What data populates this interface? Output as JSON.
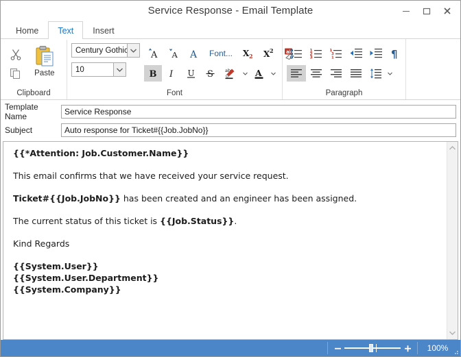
{
  "window": {
    "title": "Service Response - Email Template",
    "controls": {
      "minimize": "–",
      "maximize": "□",
      "close": "✕"
    }
  },
  "tabs": [
    {
      "label": "Home",
      "active": false
    },
    {
      "label": "Text",
      "active": true
    },
    {
      "label": "Insert",
      "active": false
    }
  ],
  "ribbon": {
    "clipboard": {
      "group_label": "Clipboard",
      "cut_label": "Cut",
      "copy_label": "Copy",
      "paste_label": "Paste"
    },
    "font": {
      "group_label": "Font",
      "font_name": "Century Gothic",
      "font_size": "10",
      "grow_font_label": "Grow Font",
      "shrink_font_label": "Shrink Font",
      "change_case_label": "A",
      "font_dialog_label": "Font...",
      "subscript_label": "Subscript",
      "superscript_label": "Superscript",
      "clear_formatting_label": "Clear Formatting",
      "bold_label": "B",
      "italic_label": "I",
      "underline_label": "U",
      "strikethrough_label": "S",
      "highlight_label": "Text Highlight",
      "font_color_label": "A"
    },
    "paragraph": {
      "group_label": "Paragraph",
      "bullets_label": "Bullets",
      "numbering_label": "Numbering",
      "multilevel_label": "Multilevel List",
      "decrease_indent_label": "Decrease Indent",
      "increase_indent_label": "Increase Indent",
      "show_marks_label": "¶",
      "align_left_label": "Align Left",
      "align_center_label": "Center",
      "align_right_label": "Align Right",
      "justify_label": "Justify",
      "line_spacing_label": "Line Spacing"
    }
  },
  "fields": {
    "template_name": {
      "label": "Template Name",
      "value": "Service Response",
      "placeholder": ""
    },
    "subject": {
      "label": "Subject",
      "value": "Auto response for Ticket#{{Job.JobNo}}",
      "placeholder": ""
    }
  },
  "body": {
    "lines": [
      {
        "html": "<b>{{*Attention: Job.Customer.Name}}</b>"
      },
      {
        "html": "This email confirms that we have received your service request."
      },
      {
        "html": "<b>Ticket#{{Job.JobNo}}</b> has been created and an engineer has been assigned."
      },
      {
        "html": "The current status of this ticket is <b>{{Job.Status}}</b>."
      },
      {
        "html": "Kind Regards"
      }
    ],
    "signature": [
      {
        "html": "<b>{{System.User}}</b>"
      },
      {
        "html": "<b>{{System.User.Department}}</b>"
      },
      {
        "html": "<b>{{System.Company}}</b>"
      }
    ]
  },
  "statusbar": {
    "zoom_out_label": "−",
    "zoom_in_label": "+",
    "zoom_percent": "100%"
  },
  "colors": {
    "accent_blue": "#1877c9",
    "statusbar_blue": "#4a86c8",
    "icon_blue": "#2a5d8f",
    "window_border": "#9a9a9a"
  }
}
